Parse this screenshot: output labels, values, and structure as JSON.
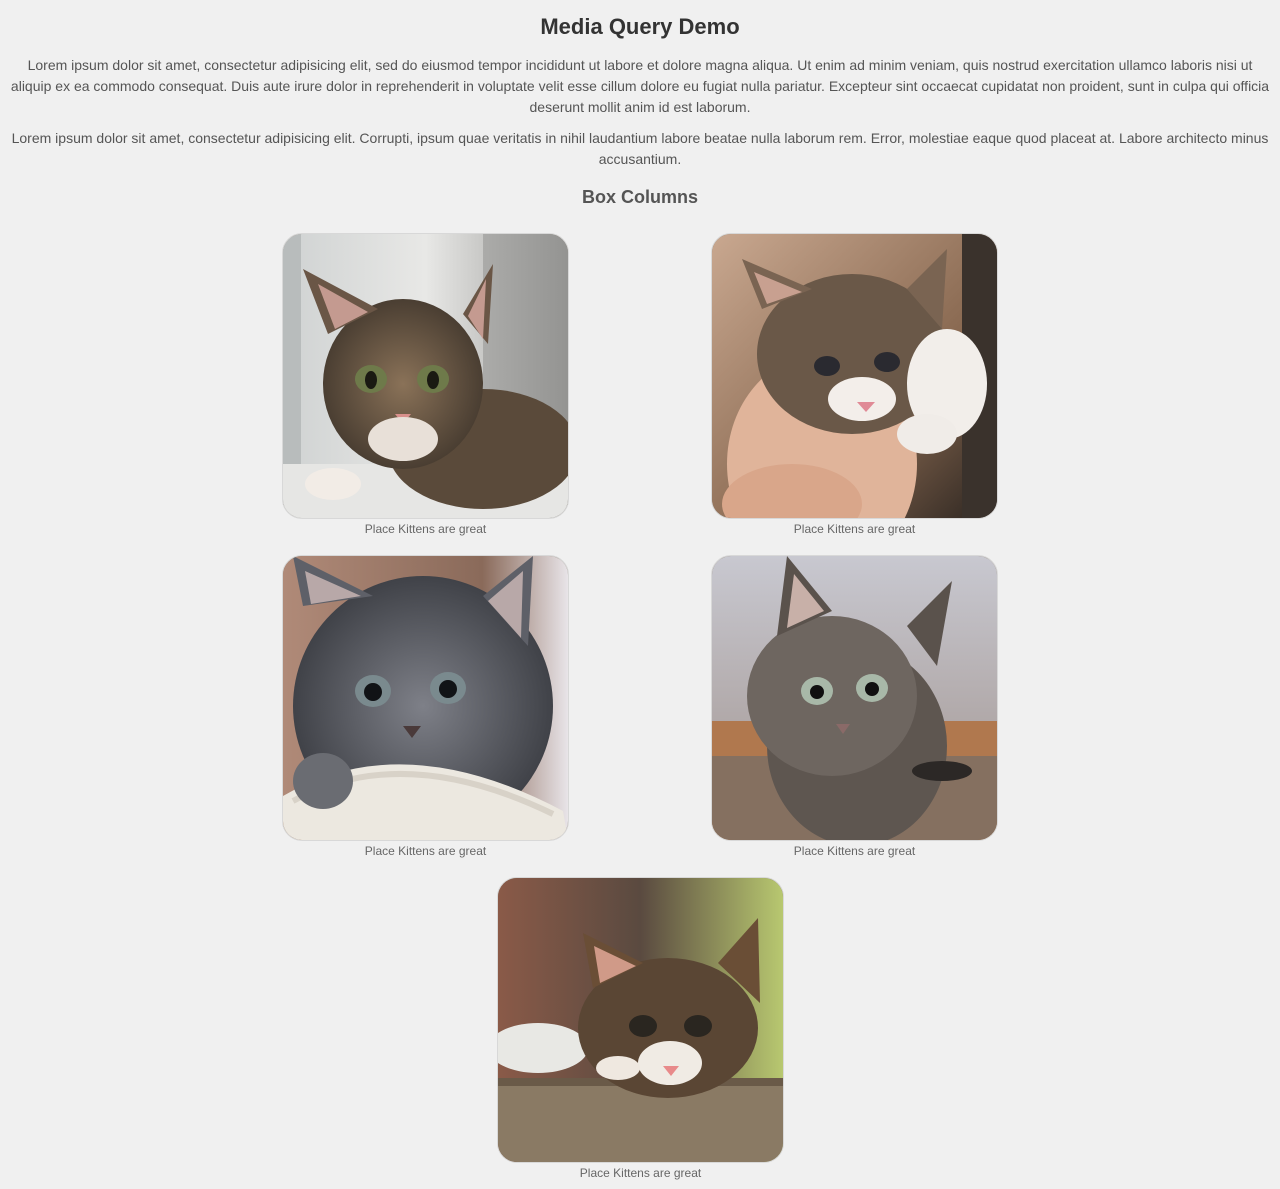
{
  "page": {
    "title": "Media Query Demo",
    "paragraphs": [
      "Lorem ipsum dolor sit amet, consectetur adipisicing elit, sed do eiusmod tempor incididunt ut labore et dolore magna aliqua. Ut enim ad minim veniam, quis nostrud exercitation ullamco laboris nisi ut aliquip ex ea commodo consequat. Duis aute irure dolor in reprehenderit in voluptate velit esse cillum dolore eu fugiat nulla pariatur. Excepteur sint occaecat cupidatat non proident, sunt in culpa qui officia deserunt mollit anim id est laborum.",
      "Lorem ipsum dolor sit amet, consectetur adipisicing elit. Corrupti, ipsum quae veritatis in nihil laudantium labore beatae nulla laborum rem. Error, molestiae eaque quod placeat at. Labore architecto minus accusantium."
    ],
    "section_title": "Box Columns"
  },
  "boxes": [
    {
      "caption": "Place Kittens are great",
      "icon": "kitten-photo"
    },
    {
      "caption": "Place Kittens are great",
      "icon": "kitten-photo"
    },
    {
      "caption": "Place Kittens are great",
      "icon": "kitten-photo"
    },
    {
      "caption": "Place Kittens are great",
      "icon": "kitten-photo"
    },
    {
      "caption": "Place Kittens are great",
      "icon": "kitten-photo"
    }
  ],
  "colors": {
    "background": "#f0f0f0",
    "heading": "#333333",
    "text": "#555555"
  }
}
